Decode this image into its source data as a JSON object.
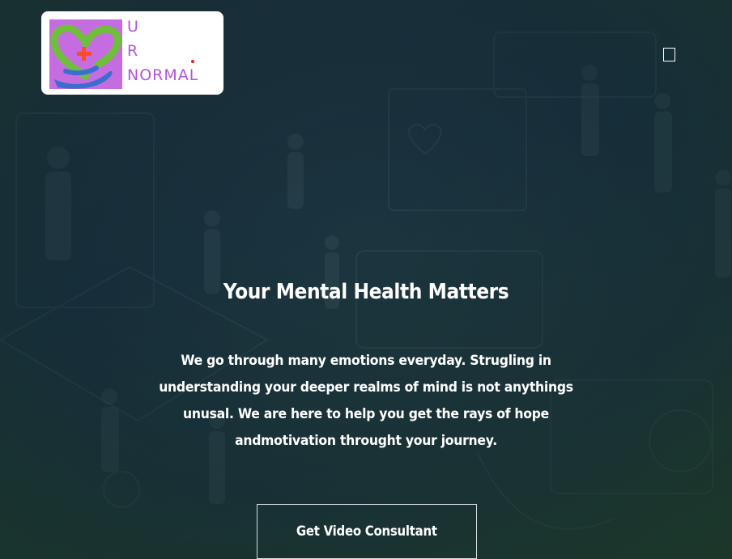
{
  "brand": {
    "logo_lines": [
      "U",
      "R",
      "NORMAL"
    ],
    "logo_text_color": "#b455d6",
    "logo_icon": "heart-hand-icon"
  },
  "header": {
    "menu_icon": "menu-toggle-icon"
  },
  "hero": {
    "title": "Your Mental Health Matters",
    "description": "We go through many emotions everyday. Strugling in understanding your deeper realms of mind is not anythings unusal. We are here to help you get the rays of hope andmotivation throught your journey.",
    "cta_label": "Get Video Consultant"
  },
  "colors": {
    "background": "#1f3a47",
    "text": "#ffffff",
    "logo_bg": "#ffffff",
    "heart_green": "#6fbf3a",
    "heart_purple": "#c56de0",
    "hand_blue": "#3a6fd0",
    "cross_red": "#ff4a2a"
  }
}
